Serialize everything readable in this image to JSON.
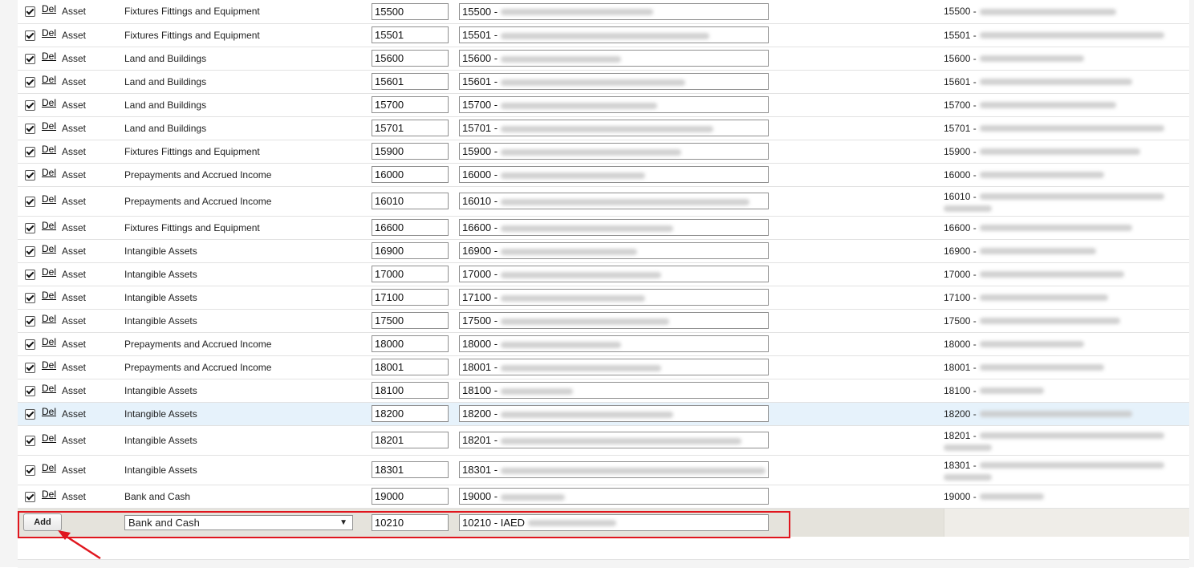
{
  "rows": [
    {
      "del": "Del",
      "type": "Asset",
      "category": "Fixtures Fittings and Equipment",
      "code": "15500",
      "desc_prefix": "15500 -",
      "preview_prefix": "15500 -",
      "checked": true,
      "tall": false,
      "hl": false,
      "bw": 190,
      "pw": 170
    },
    {
      "del": "Del",
      "type": "Asset",
      "category": "Fixtures Fittings and Equipment",
      "code": "15501",
      "desc_prefix": "15501 -",
      "preview_prefix": "15501 -",
      "checked": true,
      "tall": false,
      "hl": false,
      "bw": 260,
      "pw": 235
    },
    {
      "del": "Del",
      "type": "Asset",
      "category": "Land and Buildings",
      "code": "15600",
      "desc_prefix": "15600 -",
      "preview_prefix": "15600 -",
      "checked": true,
      "tall": false,
      "hl": false,
      "bw": 150,
      "pw": 130
    },
    {
      "del": "Del",
      "type": "Asset",
      "category": "Land and Buildings",
      "code": "15601",
      "desc_prefix": "15601 -",
      "preview_prefix": "15601 -",
      "checked": true,
      "tall": false,
      "hl": false,
      "bw": 230,
      "pw": 190
    },
    {
      "del": "Del",
      "type": "Asset",
      "category": "Land and Buildings",
      "code": "15700",
      "desc_prefix": "15700 -",
      "preview_prefix": "15700 -",
      "checked": true,
      "tall": false,
      "hl": false,
      "bw": 195,
      "pw": 170
    },
    {
      "del": "Del",
      "type": "Asset",
      "category": "Land and Buildings",
      "code": "15701",
      "desc_prefix": "15701 -",
      "preview_prefix": "15701 -",
      "checked": true,
      "tall": false,
      "hl": false,
      "bw": 265,
      "pw": 235
    },
    {
      "del": "Del",
      "type": "Asset",
      "category": "Fixtures Fittings and Equipment",
      "code": "15900",
      "desc_prefix": "15900 -",
      "preview_prefix": "15900 -",
      "checked": true,
      "tall": false,
      "hl": false,
      "bw": 225,
      "pw": 200
    },
    {
      "del": "Del",
      "type": "Asset",
      "category": "Prepayments and Accrued Income",
      "code": "16000",
      "desc_prefix": "16000 -",
      "preview_prefix": "16000 -",
      "checked": true,
      "tall": false,
      "hl": false,
      "bw": 180,
      "pw": 155
    },
    {
      "del": "Del",
      "type": "Asset",
      "category": "Prepayments and Accrued Income",
      "code": "16010",
      "desc_prefix": "16010 -",
      "preview_prefix": "16010 -",
      "checked": true,
      "tall": true,
      "hl": false,
      "bw": 310,
      "pw": 250
    },
    {
      "del": "Del",
      "type": "Asset",
      "category": "Fixtures Fittings and Equipment",
      "code": "16600",
      "desc_prefix": "16600 -",
      "preview_prefix": "16600 -",
      "checked": true,
      "tall": false,
      "hl": false,
      "bw": 215,
      "pw": 190
    },
    {
      "del": "Del",
      "type": "Asset",
      "category": "Intangible Assets",
      "code": "16900",
      "desc_prefix": "16900 -",
      "preview_prefix": "16900 -",
      "checked": true,
      "tall": false,
      "hl": false,
      "bw": 170,
      "pw": 145
    },
    {
      "del": "Del",
      "type": "Asset",
      "category": "Intangible Assets",
      "code": "17000",
      "desc_prefix": "17000 -",
      "preview_prefix": "17000 -",
      "checked": true,
      "tall": false,
      "hl": false,
      "bw": 200,
      "pw": 180
    },
    {
      "del": "Del",
      "type": "Asset",
      "category": "Intangible Assets",
      "code": "17100",
      "desc_prefix": "17100 -",
      "preview_prefix": "17100 -",
      "checked": true,
      "tall": false,
      "hl": false,
      "bw": 180,
      "pw": 160
    },
    {
      "del": "Del",
      "type": "Asset",
      "category": "Intangible Assets",
      "code": "17500",
      "desc_prefix": "17500 -",
      "preview_prefix": "17500 -",
      "checked": true,
      "tall": false,
      "hl": false,
      "bw": 210,
      "pw": 175
    },
    {
      "del": "Del",
      "type": "Asset",
      "category": "Prepayments and Accrued Income",
      "code": "18000",
      "desc_prefix": "18000 -",
      "preview_prefix": "18000 -",
      "checked": true,
      "tall": false,
      "hl": false,
      "bw": 150,
      "pw": 130
    },
    {
      "del": "Del",
      "type": "Asset",
      "category": "Prepayments and Accrued Income",
      "code": "18001",
      "desc_prefix": "18001 -",
      "preview_prefix": "18001 -",
      "checked": true,
      "tall": false,
      "hl": false,
      "bw": 200,
      "pw": 155
    },
    {
      "del": "Del",
      "type": "Asset",
      "category": "Intangible Assets",
      "code": "18100",
      "desc_prefix": "18100 -",
      "preview_prefix": "18100 -",
      "checked": true,
      "tall": false,
      "hl": false,
      "bw": 90,
      "pw": 80
    },
    {
      "del": "Del",
      "type": "Asset",
      "category": "Intangible Assets",
      "code": "18200",
      "desc_prefix": "18200 -",
      "preview_prefix": "18200 -",
      "checked": true,
      "tall": false,
      "hl": true,
      "bw": 215,
      "pw": 190
    },
    {
      "del": "Del",
      "type": "Asset",
      "category": "Intangible Assets",
      "code": "18201",
      "desc_prefix": "18201 -",
      "preview_prefix": "18201 -",
      "checked": true,
      "tall": true,
      "hl": false,
      "bw": 300,
      "pw": 230
    },
    {
      "del": "Del",
      "type": "Asset",
      "category": "Intangible Assets",
      "code": "18301",
      "desc_prefix": "18301 -",
      "preview_prefix": "18301 -",
      "checked": true,
      "tall": true,
      "hl": false,
      "bw": 330,
      "pw": 250
    },
    {
      "del": "Del",
      "type": "Asset",
      "category": "Bank and Cash",
      "code": "19000",
      "desc_prefix": "19000 -",
      "preview_prefix": "19000 -",
      "checked": true,
      "tall": false,
      "hl": false,
      "bw": 80,
      "pw": 80
    }
  ],
  "add_row": {
    "button_label": "Add",
    "category_selected": "Bank and Cash",
    "code_value": "10210",
    "desc_value": "10210 - IAED",
    "select_icon": "chevron-down-icon"
  },
  "colors": {
    "highlight_box": "#e0161e",
    "arrow": "#e0161e",
    "selected_row": "#e6f2fb",
    "add_row_bg": "#e5e3dc"
  }
}
